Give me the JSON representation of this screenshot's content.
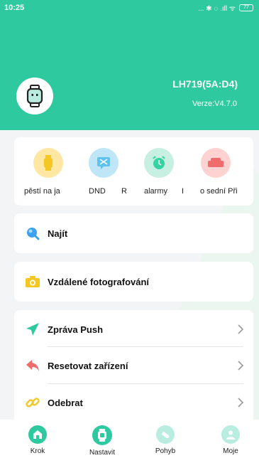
{
  "status_bar": {
    "time": "10:25",
    "indicators": "... ✱ ◌ .ıll ᯤ",
    "battery": "77"
  },
  "device": {
    "name": "LH719(5A:D4)",
    "version": "Verze:V4.7.0"
  },
  "quick_actions": [
    {
      "label": "pěstí na ja",
      "color": "#fde7a3",
      "icon": "watch-icon"
    },
    {
      "label": "DND",
      "color": "#bfe6f7",
      "icon": "dnd-icon"
    },
    {
      "label": "R",
      "color": "#ffffff",
      "icon": ""
    },
    {
      "label": "alarmy",
      "color": "#c7f0e3",
      "icon": "alarm-clock-icon"
    },
    {
      "label": "I",
      "color": "#ffffff",
      "icon": ""
    },
    {
      "label": "o sední Při",
      "color": "#ffd2d2",
      "icon": "sofa-icon"
    }
  ],
  "menu": {
    "find": "Najít",
    "remote_photo": "Vzdálené fotografování",
    "push_message": "Zpráva Push",
    "reset_device": "Resetovat zařízení",
    "unbind": "Odebrat"
  },
  "tabs": [
    "Krok",
    "Nastavit",
    "Pohyb",
    "Moje"
  ],
  "colors": {
    "primary": "#2ec99e",
    "background": "#f3f4f6",
    "quick_yellow": "#f6c623",
    "quick_blue": "#5ec2ee",
    "quick_green": "#36d3a2",
    "quick_red": "#f06b6b"
  }
}
